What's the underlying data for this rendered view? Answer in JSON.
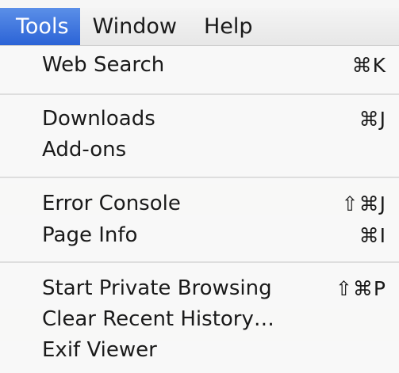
{
  "menubar": {
    "items": [
      {
        "label": "Tools",
        "active": true
      },
      {
        "label": "Window",
        "active": false
      },
      {
        "label": "Help",
        "active": false
      }
    ]
  },
  "menu": {
    "items": [
      {
        "label": "Web Search",
        "shortcut": "⌘K"
      },
      {
        "label": "Downloads",
        "shortcut": "⌘J"
      },
      {
        "label": "Add-ons",
        "shortcut": ""
      },
      {
        "label": "Error Console",
        "shortcut": "⇧⌘J"
      },
      {
        "label": "Page Info",
        "shortcut": "⌘I"
      },
      {
        "label": "Start Private Browsing",
        "shortcut": "⇧⌘P"
      },
      {
        "label": "Clear Recent History…",
        "shortcut": ""
      },
      {
        "label": "Exif Viewer",
        "shortcut": ""
      }
    ]
  },
  "colors": {
    "highlight": "#2b63d6",
    "menu_background": "#f6f6f6",
    "separator": "#dedede"
  }
}
